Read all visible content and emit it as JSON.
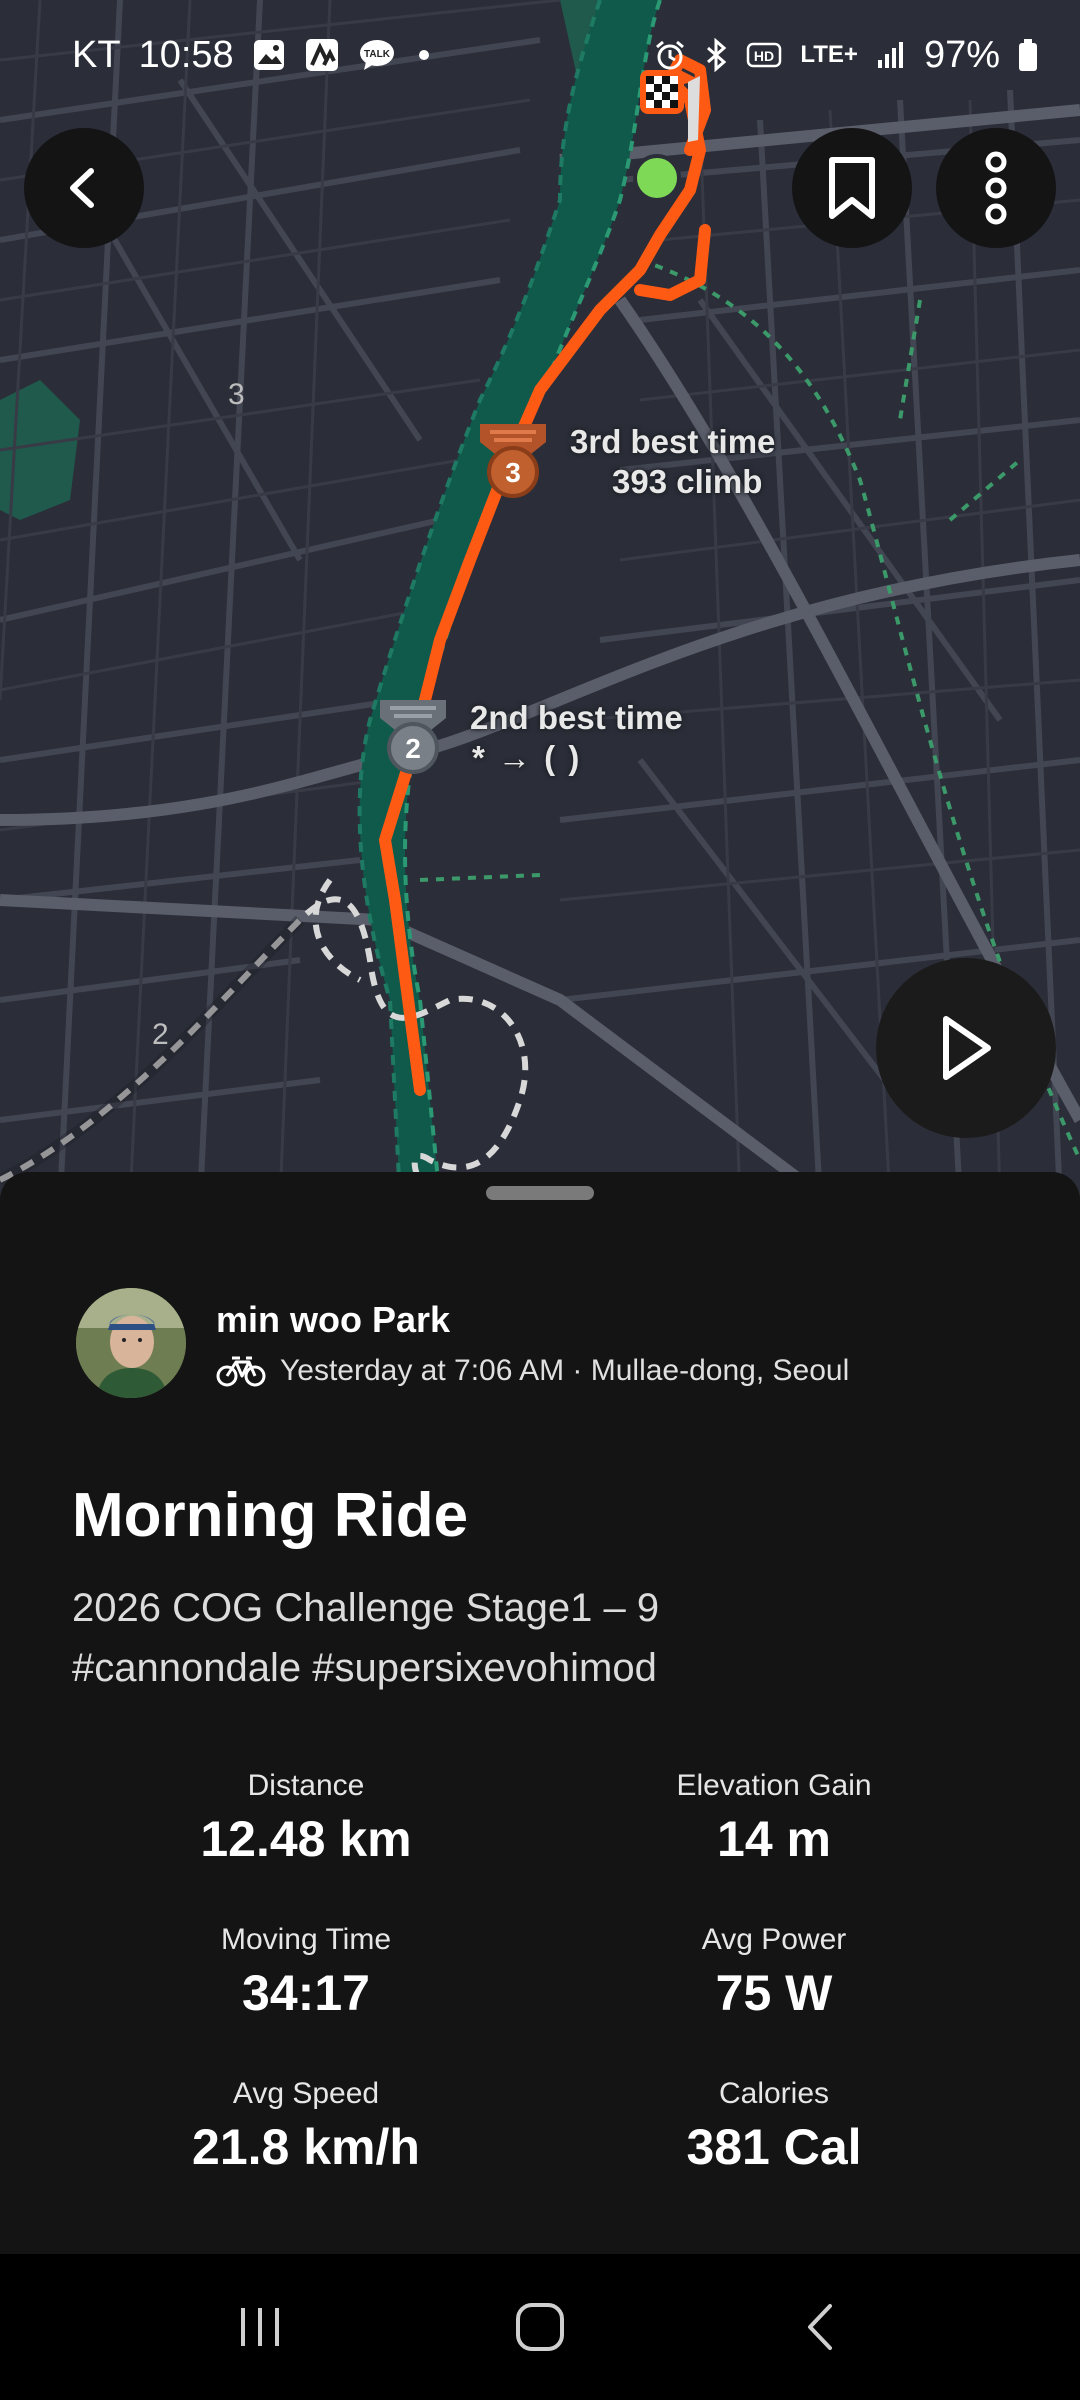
{
  "status_bar": {
    "carrier": "KT",
    "time": "10:58",
    "network": "LTE+",
    "battery": "97%"
  },
  "map": {
    "segments": [
      {
        "rank_label": "3rd best time",
        "segment_name": "393 climb",
        "medal": "3"
      },
      {
        "rank_label": "2nd best time",
        "segment_name": "* → ( )",
        "medal": "2"
      }
    ],
    "grid_numbers": [
      "3",
      "2"
    ],
    "colors": {
      "route": "#ff5a14",
      "road": "#4a4e5a",
      "river": "#0f5a4a",
      "park": "#1f5a4c",
      "start_dot": "#7ed957"
    }
  },
  "controls": {
    "back_icon": "chevron-left-icon",
    "bookmark_icon": "bookmark-icon",
    "more_icon": "more-vertical-icon",
    "play_icon": "play-icon"
  },
  "activity": {
    "athlete_name": "min woo Park",
    "meta": "Yesterday at 7:06 AM · Mullae-dong, Seoul",
    "title": "Morning Ride",
    "description_line1": "2026  COG Challenge Stage1 – 9",
    "description_line2": "#cannondale  #supersixevohimod",
    "stats": [
      {
        "label": "Distance",
        "value": "12.48 km"
      },
      {
        "label": "Elevation Gain",
        "value": "14 m"
      },
      {
        "label": "Moving Time",
        "value": "34:17"
      },
      {
        "label": "Avg Power",
        "value": "75 W"
      },
      {
        "label": "Avg Speed",
        "value": "21.8 km/h"
      },
      {
        "label": "Calories",
        "value": "381 Cal"
      }
    ]
  }
}
